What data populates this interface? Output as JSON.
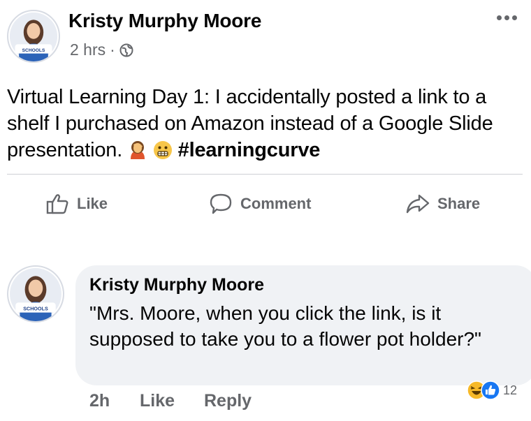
{
  "post": {
    "author": "Kristy Murphy Moore",
    "time": "2 hrs",
    "separator": "·",
    "text": "Virtual Learning Day 1: I accidentally posted a link to a shelf I purchased on Amazon instead of a Google Slide presentation.",
    "hashtag": "#learningcurve",
    "avatar_badge": "SCHOOLS",
    "icons": [
      "globe-icon",
      "more-options-icon",
      "facepalm-emoji",
      "grimace-emoji"
    ]
  },
  "actions": {
    "like": "Like",
    "comment": "Comment",
    "share": "Share"
  },
  "comment": {
    "author": "Kristy Murphy Moore",
    "text": "\"Mrs. Moore, when you click the link, is it supposed to take you to a flower pot holder?\"",
    "time": "2h",
    "like": "Like",
    "reply": "Reply",
    "reaction_count": "12",
    "avatar_badge": "SCHOOLS"
  },
  "colors": {
    "text": "#050505",
    "secondary": "#65676b",
    "bubble": "#f0f2f5",
    "like_blue": "#1877f2",
    "haha_yellow": "#f7b928"
  }
}
